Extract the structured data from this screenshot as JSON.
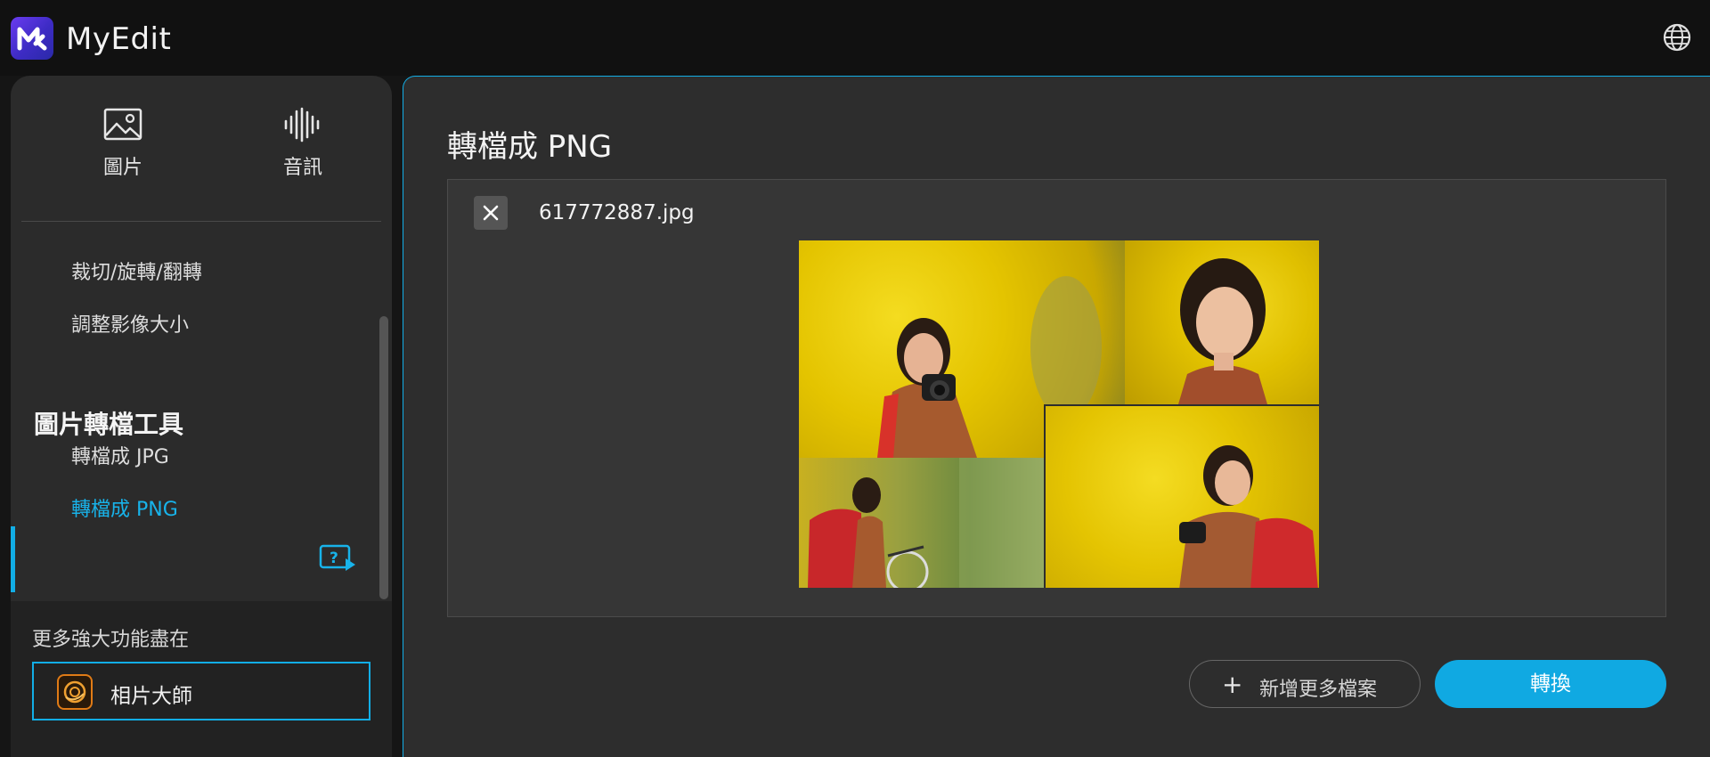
{
  "app": {
    "name": "MyEdit"
  },
  "header": {
    "language_icon": "globe-icon"
  },
  "sidebar": {
    "media_tabs": [
      {
        "label": "圖片",
        "icon": "image-icon"
      },
      {
        "label": "音訊",
        "icon": "audio-wave-icon"
      }
    ],
    "items_top": [
      {
        "label": "裁切/旋轉/翻轉"
      },
      {
        "label": "調整影像大小"
      }
    ],
    "section_title": "圖片轉檔工具",
    "items_convert": [
      {
        "label": "轉檔成 JPG",
        "active": false
      },
      {
        "label": "轉檔成 PNG",
        "active": true
      }
    ],
    "help_icon": "video-help-icon",
    "promo": {
      "text": "更多強大功能盡在",
      "app_label": "相片大師"
    }
  },
  "main": {
    "title": "轉檔成 PNG",
    "file": {
      "name": "617772887.jpg"
    },
    "add_files_label": "新增更多檔案",
    "convert_label": "轉換"
  },
  "colors": {
    "accent": "#12aee6",
    "background": "#151515",
    "panel": "#2d2d2d"
  }
}
